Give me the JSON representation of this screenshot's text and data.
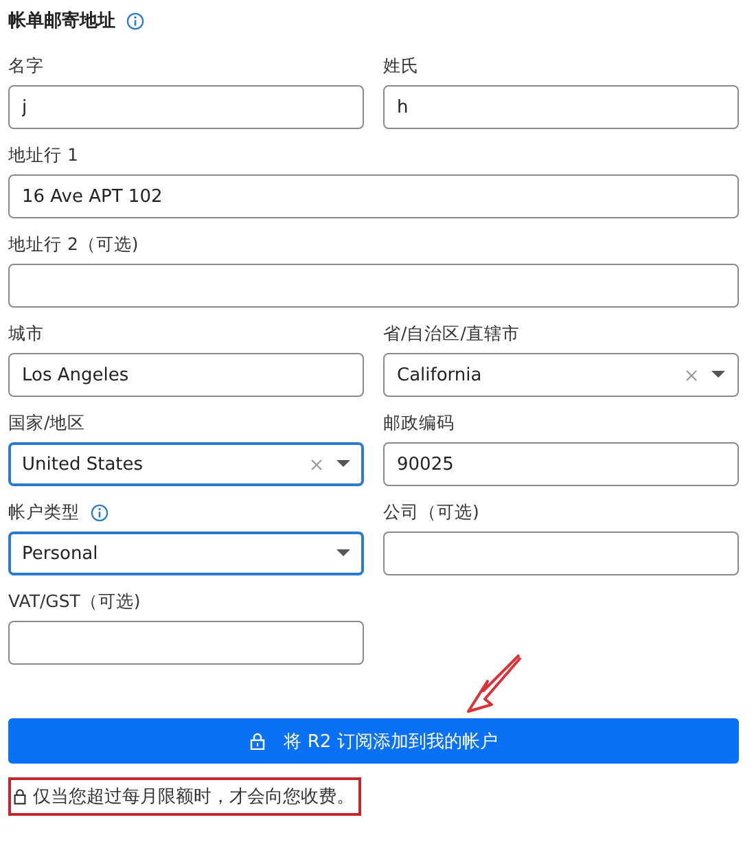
{
  "section": {
    "title": "帐单邮寄地址",
    "info": true
  },
  "rows": [
    [
      {
        "label": "名字",
        "info": false,
        "kind": "text",
        "value": "j",
        "focused": false
      },
      {
        "label": "姓氏",
        "info": false,
        "kind": "text",
        "value": "h",
        "focused": false
      }
    ],
    [
      {
        "label": "地址行 1",
        "info": false,
        "kind": "text",
        "value": "16 Ave APT 102",
        "focused": false,
        "wide": true
      }
    ],
    [
      {
        "label": "地址行 2（可选)",
        "info": false,
        "kind": "text",
        "focused": false,
        "wide": true
      }
    ],
    [
      {
        "label": "城市",
        "info": false,
        "kind": "text",
        "value": "Los Angeles",
        "focused": false
      },
      {
        "label": "省/自治区/直辖市",
        "info": false,
        "kind": "select",
        "value": "California",
        "clearable": true,
        "focused": false
      }
    ],
    [
      {
        "label": "国家/地区",
        "info": false,
        "kind": "select",
        "value": "United States",
        "clearable": true,
        "focused": true
      },
      {
        "label": "邮政编码",
        "info": false,
        "kind": "text",
        "value": "90025",
        "focused": false
      }
    ],
    [
      {
        "label": "帐户类型",
        "info": true,
        "kind": "select",
        "value": "Personal",
        "clearable": false,
        "focused": true
      },
      {
        "label": "公司（可选)",
        "info": false,
        "kind": "text",
        "focused": false
      }
    ],
    [
      {
        "label": "VAT/GST（可选)",
        "info": false,
        "kind": "text",
        "focused": false
      }
    ]
  ],
  "submit": {
    "label": "将 R2 订阅添加到我的帐户"
  },
  "note": {
    "text": "仅当您超过每月限额时，才会向您收费。",
    "highlighted": true
  }
}
